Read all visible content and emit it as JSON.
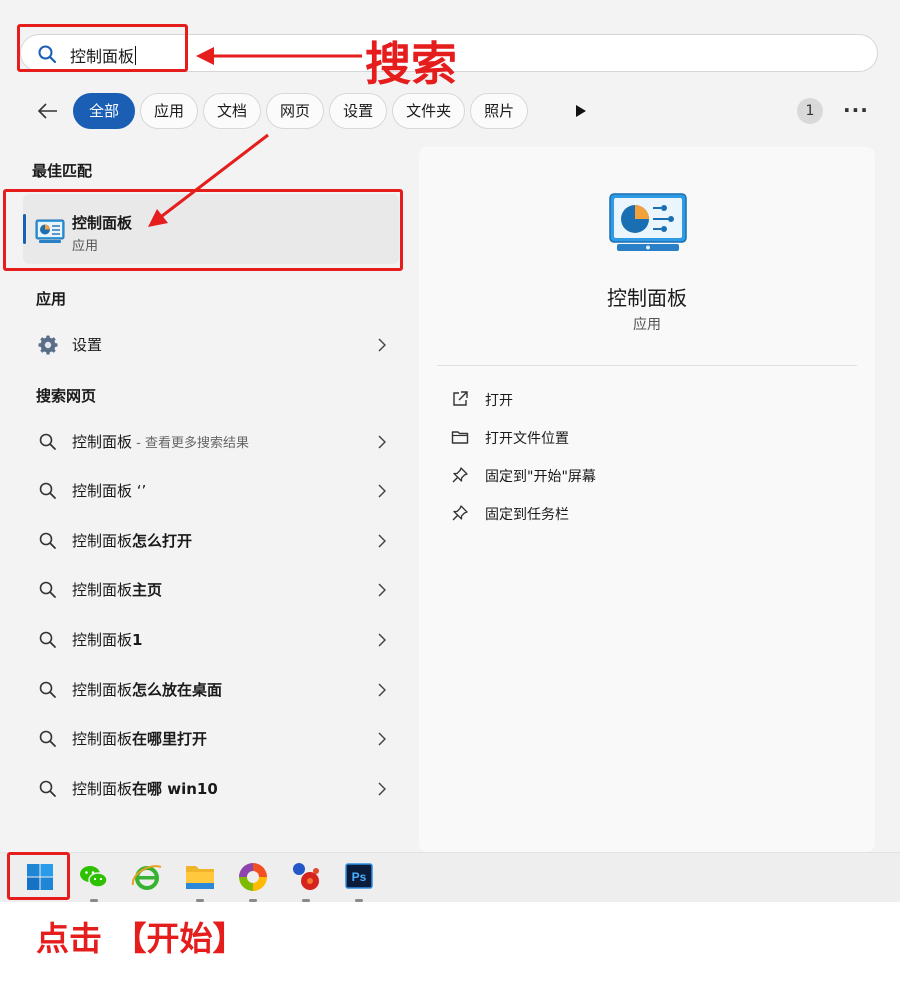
{
  "search": {
    "query": "控制面板"
  },
  "filters": {
    "chips": [
      {
        "label": "全部",
        "active": true
      },
      {
        "label": "应用",
        "active": false
      },
      {
        "label": "文档",
        "active": false
      },
      {
        "label": "网页",
        "active": false
      },
      {
        "label": "设置",
        "active": false
      },
      {
        "label": "文件夹",
        "active": false
      },
      {
        "label": "照片",
        "active": false
      }
    ],
    "count_badge": "1"
  },
  "best_match": {
    "section_title": "最佳匹配",
    "name": "控制面板",
    "type": "应用"
  },
  "apps": {
    "section_title": "应用",
    "items": [
      {
        "label": "设置"
      }
    ]
  },
  "web": {
    "section_title": "搜索网页",
    "items": [
      {
        "prefix": "控制面板",
        "bold": "",
        "suffix": " - 查看更多搜索结果"
      },
      {
        "prefix": "控制面板 ‘’",
        "bold": "",
        "suffix": ""
      },
      {
        "prefix": "控制面板",
        "bold": "怎么打开",
        "suffix": ""
      },
      {
        "prefix": "控制面板",
        "bold": "主页",
        "suffix": ""
      },
      {
        "prefix": "控制面板",
        "bold": "1",
        "suffix": ""
      },
      {
        "prefix": "控制面板",
        "bold": "怎么放在桌面",
        "suffix": ""
      },
      {
        "prefix": "控制面板",
        "bold": "在哪里打开",
        "suffix": ""
      },
      {
        "prefix": "控制面板",
        "bold": "在哪 win10",
        "suffix": ""
      }
    ]
  },
  "detail": {
    "name": "控制面板",
    "type": "应用",
    "actions": [
      {
        "label": "打开",
        "icon": "open-external-icon"
      },
      {
        "label": "打开文件位置",
        "icon": "folder-icon"
      },
      {
        "label": "固定到\"开始\"屏幕",
        "icon": "pin-icon"
      },
      {
        "label": "固定到任务栏",
        "icon": "pin-icon"
      }
    ]
  },
  "taskbar": {
    "icons": [
      "windows-start-icon",
      "wechat-icon",
      "ie-browser-icon",
      "file-explorer-icon",
      "photos-app-icon",
      "paint-app-icon",
      "photoshop-icon"
    ],
    "photoshop_label": "Ps"
  },
  "annotations": {
    "search_label": "搜索",
    "start_label": "点击 【开始】"
  },
  "colors": {
    "accent": "#1a5fb4",
    "annotation_red": "#e51d1d"
  }
}
